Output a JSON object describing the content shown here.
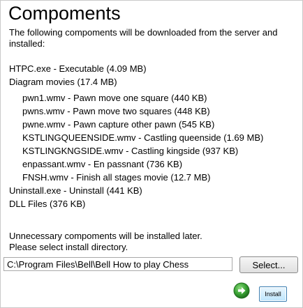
{
  "window": {
    "title": "Compoments",
    "intro": "The following compoments will be downloaded from the server and installed:"
  },
  "items": [
    "HTPC.exe - Executable (4.09 MB)",
    "Diagram movies (17.4 MB)"
  ],
  "movies": [
    "pwn1.wmv - Pawn move one square (440 KB)",
    "pwns.wmv - Pawn move two squares (448 KB)",
    "pwne.wmv - Pawn capture other pawn (545 KB)",
    "KSTLINGQUEENSIDE.wmv - Castling queenside (1.69 MB)",
    "KSTLINGKNGSIDE.wmv - Castling kingside (937 KB)",
    "enpassant.wmv - En passnant (736 KB)",
    "FNSH.wmv - Finish all stages movie (12.7 MB)"
  ],
  "items_after": [
    "Uninstall.exe - Uninstall (441 KB)",
    "DLL Files (376 KB)"
  ],
  "note": {
    "line1": "Unnecessary compoments will be installed later.",
    "line2": "Please select install directory."
  },
  "install_dir": {
    "value": "C:\\Program Files\\Bell\\Bell How to play Chess"
  },
  "buttons": {
    "select_label": "Select...",
    "install_label": "Install"
  },
  "icons": {
    "next_icon": "green-arrow-right-icon"
  },
  "colors": {
    "next_icon_green": "#3aa335"
  }
}
